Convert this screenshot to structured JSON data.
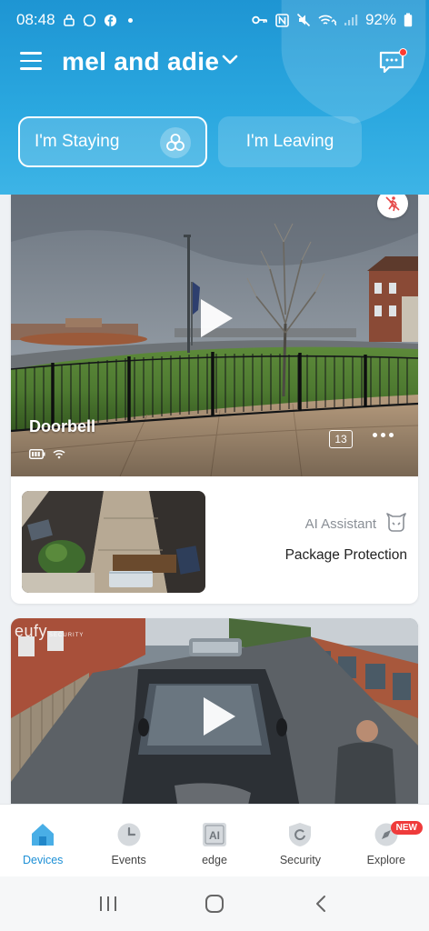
{
  "status_bar": {
    "time": "08:48",
    "battery": "92%"
  },
  "header": {
    "home_name": "mel and adie",
    "modes": {
      "staying": "I'm Staying",
      "leaving": "I'm Leaving"
    }
  },
  "devices": [
    {
      "name": "Doorbell",
      "event_count": "13",
      "ai_label": "AI Assistant",
      "ai_feature": "Package Protection"
    },
    {
      "brand_watermark": "eufy",
      "brand_sub": "SECURITY"
    }
  ],
  "bottom_nav": [
    {
      "label": "Devices",
      "icon": "home-icon",
      "active": true
    },
    {
      "label": "Events",
      "icon": "clock-icon"
    },
    {
      "label": "edge",
      "icon": "ai-chip-icon"
    },
    {
      "label": "Security",
      "icon": "shield-icon"
    },
    {
      "label": "Explore",
      "icon": "explore-icon",
      "badge": "NEW"
    }
  ],
  "colors": {
    "brand_blue": "#1e95d3",
    "active_nav": "#1e90d6",
    "badge_red": "#ef3b3b"
  }
}
